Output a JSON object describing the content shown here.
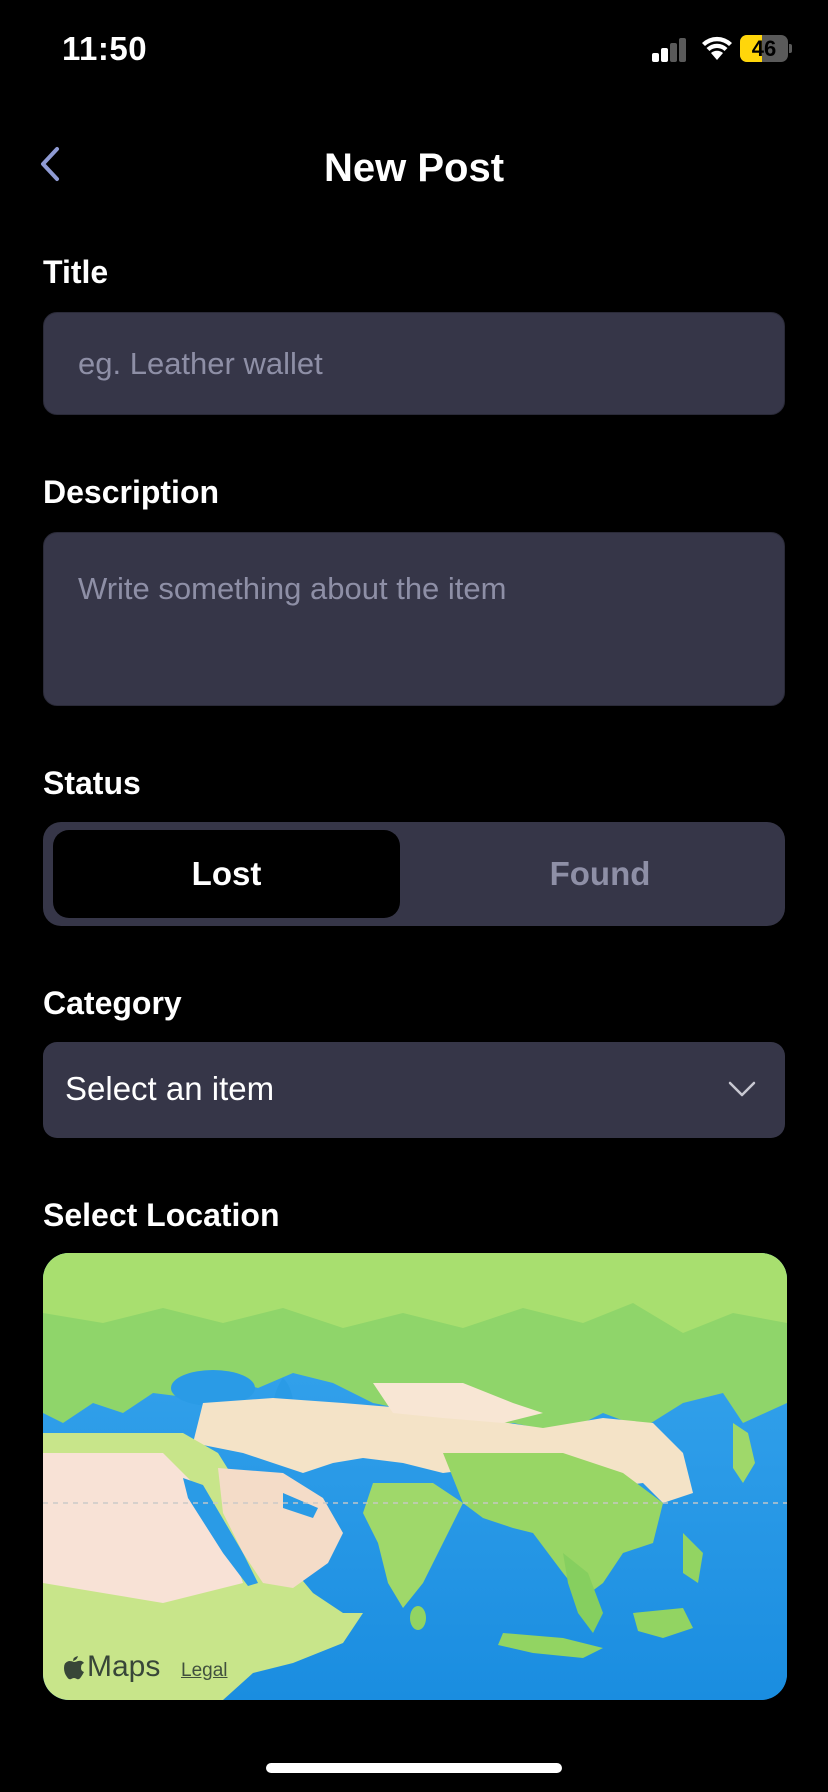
{
  "status_bar": {
    "time": "11:50",
    "battery_level": "46",
    "battery_fraction": 0.46,
    "battery_color": "#ffd60a"
  },
  "nav": {
    "title": "New Post",
    "back_icon": "chevron-left-icon"
  },
  "form": {
    "title_label": "Title",
    "title_placeholder": "eg. Leather wallet",
    "description_label": "Description",
    "description_placeholder": "Write something about the item",
    "status_label": "Status",
    "status_options": [
      "Lost",
      "Found"
    ],
    "status_selected": "Lost",
    "category_label": "Category",
    "category_value": "Select an item",
    "location_label": "Select Location"
  },
  "map": {
    "brand": "Maps",
    "legal": "Legal"
  },
  "colors": {
    "background": "#000000",
    "field": "#363648",
    "placeholder": "#8e8fa6",
    "accent_text": "#ffffff"
  }
}
